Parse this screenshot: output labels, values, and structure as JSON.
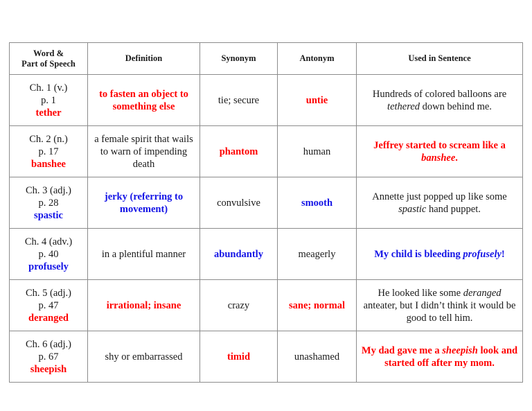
{
  "table": {
    "headers": [
      {
        "lines": [
          "Word &",
          "Part of Speech"
        ]
      },
      {
        "lines": [
          "Definition"
        ]
      },
      {
        "lines": [
          "Synonym"
        ]
      },
      {
        "lines": [
          "Antonym"
        ]
      },
      {
        "lines": [
          "Used in Sentence"
        ]
      }
    ],
    "rows": [
      {
        "chapter": "Ch. 1 (v.)",
        "page": "p. 1",
        "word": "tether",
        "word_color": "red",
        "definition": "to fasten an object to something else",
        "definition_style": "bold-red",
        "synonym": "tie; secure",
        "synonym_style": "plain",
        "antonym": "untie",
        "antonym_style": "bold-red",
        "sentence": {
          "before": "Hundreds of colored balloons are ",
          "italic": "tethered",
          "after": " down behind me."
        },
        "sentence_style": "plain"
      },
      {
        "chapter": "Ch. 2 (n.)",
        "page": "p. 17",
        "word": "banshee",
        "word_color": "red",
        "definition": "a female spirit that wails to warn of impending death",
        "definition_style": "plain",
        "synonym": "phantom",
        "synonym_style": "bold-red",
        "antonym": "human",
        "antonym_style": "plain",
        "sentence": {
          "before": "Jeffrey started to scream like a ",
          "italic": "banshee",
          "after": "."
        },
        "sentence_style": "bold-red"
      },
      {
        "chapter": "Ch. 3 (adj.)",
        "page": "p. 28",
        "word": "spastic",
        "word_color": "blue",
        "definition": "jerky (referring to movement)",
        "definition_style": "bold-blue",
        "synonym": "convulsive",
        "synonym_style": "plain",
        "antonym": "smooth",
        "antonym_style": "bold-blue",
        "sentence": {
          "before": "Annette just popped up like some ",
          "italic": "spastic",
          "after": " hand puppet."
        },
        "sentence_style": "plain"
      },
      {
        "chapter": "Ch. 4 (adv.)",
        "page": "p. 40",
        "word": "profusely",
        "word_color": "blue",
        "definition": "in a plentiful manner",
        "definition_style": "plain",
        "synonym": "abundantly",
        "synonym_style": "bold-blue",
        "antonym": "meagerly",
        "antonym_style": "plain",
        "sentence": {
          "before": "My child is bleeding ",
          "italic": "profusely",
          "after": "!"
        },
        "sentence_style": "bold-blue"
      },
      {
        "chapter": "Ch. 5 (adj.)",
        "page": "p. 47",
        "word": "deranged",
        "word_color": "red",
        "definition": "irrational; insane",
        "definition_style": "bold-red",
        "synonym": "crazy",
        "synonym_style": "plain",
        "antonym": "sane; normal",
        "antonym_style": "bold-red",
        "sentence": {
          "before": "He looked like some ",
          "italic": "deranged",
          "after": " anteater, but I didn’t think it would be good to tell him."
        },
        "sentence_style": "plain"
      },
      {
        "chapter": "Ch. 6 (adj.)",
        "page": "p. 67",
        "word": "sheepish",
        "word_color": "red",
        "definition": "shy or embarrassed",
        "definition_style": "plain",
        "synonym": "timid",
        "synonym_style": "bold-red",
        "antonym": "unashamed",
        "antonym_style": "plain",
        "sentence": {
          "before": "My dad gave me a ",
          "italic": "sheepish",
          "after": " look and started off after my mom."
        },
        "sentence_style": "bold-red"
      }
    ]
  },
  "colors": {
    "red": "#ff0000",
    "blue": "#1414e6",
    "text": "#1a1a1a",
    "border": "#8c8c8c"
  }
}
